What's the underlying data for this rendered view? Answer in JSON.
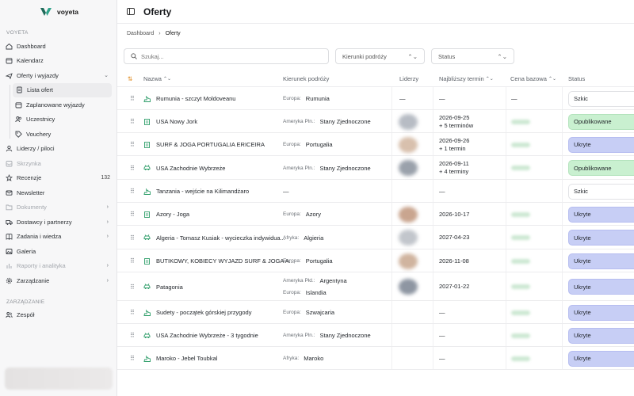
{
  "app": {
    "brand": "voyeta",
    "section_main": "VOYETA",
    "section_admin": "ZARZĄDZANIE"
  },
  "sidebar": {
    "items": [
      {
        "label": "Dashboard",
        "icon": "home-icon"
      },
      {
        "label": "Kalendarz",
        "icon": "calendar-icon"
      },
      {
        "label": "Oferty i wyjazdy",
        "icon": "plane-icon",
        "expanded": true
      },
      {
        "label": "Lista ofert",
        "icon": "doc-icon",
        "active": true
      },
      {
        "label": "Zaplanowane wyjazdy",
        "icon": "calendar-icon"
      },
      {
        "label": "Uczestnicy",
        "icon": "users-icon"
      },
      {
        "label": "Vouchery",
        "icon": "tag-icon"
      },
      {
        "label": "Liderzy / piloci",
        "icon": "user-icon"
      },
      {
        "label": "Skrzynka",
        "icon": "inbox-icon",
        "disabled": true
      },
      {
        "label": "Recenzje",
        "icon": "star-icon",
        "count": "132"
      },
      {
        "label": "Newsletter",
        "icon": "mail-icon"
      },
      {
        "label": "Dokumenty",
        "icon": "folder-icon",
        "disabled": true
      },
      {
        "label": "Dostawcy i partnerzy",
        "icon": "truck-icon"
      },
      {
        "label": "Zadania i wiedza",
        "icon": "book-icon"
      },
      {
        "label": "Galeria",
        "icon": "image-icon"
      },
      {
        "label": "Raporty i analityka",
        "icon": "chart-icon",
        "disabled": true
      },
      {
        "label": "Zarządzanie",
        "icon": "gear-icon"
      },
      {
        "label": "Zespół",
        "icon": "team-icon"
      }
    ]
  },
  "header": {
    "title": "Oferty"
  },
  "breadcrumb": {
    "root": "Dashboard",
    "current": "Oferty"
  },
  "filters": {
    "search_placeholder": "Szukaj...",
    "direction_placeholder": "Kierunki podróży",
    "status_placeholder": "Status"
  },
  "table": {
    "columns": {
      "name": "Nazwa",
      "direction": "Kierunek podróży",
      "leaders": "Liderzy",
      "next_term": "Najbliższy termin",
      "price": "Cena bazowa",
      "status": "Status"
    },
    "rows": [
      {
        "name": "Rumunia - szczyt Moldoveanu",
        "icon": "hiking-icon",
        "dirs": [
          {
            "region": "Europa:",
            "country": "Rumunia"
          }
        ],
        "leaders": "—",
        "term": [
          "—"
        ],
        "price": "—",
        "status": "Szkic",
        "status_kind": "szkic"
      },
      {
        "name": "USA Nowy Jork",
        "icon": "building-icon",
        "dirs": [
          {
            "region": "Ameryka Pln.:",
            "country": "Stany Zjednoczone"
          }
        ],
        "avatar": true,
        "term": [
          "2026-09-25",
          "+ 5 terminów"
        ],
        "price_blur": true,
        "status": "Opublikowane",
        "status_kind": "opub"
      },
      {
        "name": "SURF & JOGA PORTUGALIA ERICEIRA",
        "icon": "building-icon",
        "dirs": [
          {
            "region": "Europa:",
            "country": "Portugalia"
          }
        ],
        "avatar": true,
        "term": [
          "2026-09-26",
          "+ 1 termin"
        ],
        "price_blur": true,
        "status": "Ukryte",
        "status_kind": "ukryte"
      },
      {
        "name": "USA Zachodnie Wybrzeże",
        "icon": "car-icon",
        "dirs": [
          {
            "region": "Ameryka Pln.:",
            "country": "Stany Zjednoczone"
          }
        ],
        "avatar": true,
        "term": [
          "2026-09-11",
          "+ 4 terminy"
        ],
        "price_blur": true,
        "status": "Opublikowane",
        "status_kind": "opub"
      },
      {
        "name": "Tanzania - wejście na Kilimandżaro",
        "icon": "hiking-icon",
        "dirs": [],
        "dir_dash": "—",
        "term": [
          "—"
        ],
        "status": "Szkic",
        "status_kind": "szkic"
      },
      {
        "name": "Azory - Joga",
        "icon": "building-icon",
        "dirs": [
          {
            "region": "Europa:",
            "country": "Azory"
          }
        ],
        "avatar": true,
        "term": [
          "2026-10-17"
        ],
        "price_blur": true,
        "status": "Ukryte",
        "status_kind": "ukryte"
      },
      {
        "name": "Algeria - Tomasz Kusiak - wycieczka indywidua...",
        "icon": "car-icon",
        "dirs": [
          {
            "region": "Afryka:",
            "country": "Algieria"
          }
        ],
        "avatar": true,
        "term": [
          "2027-04-23"
        ],
        "price_blur": true,
        "status": "Ukryte",
        "status_kind": "ukryte"
      },
      {
        "name": "BUTIKOWY, KOBIECY WYJAZD SURF & JOGA A...",
        "icon": "building-icon",
        "dirs": [
          {
            "region": "Europa:",
            "country": "Portugalia"
          }
        ],
        "avatar": true,
        "term": [
          "2026-11-08"
        ],
        "price_blur": true,
        "status": "Ukryte",
        "status_kind": "ukryte"
      },
      {
        "name": "Patagonia",
        "icon": "car-icon",
        "dirs": [
          {
            "region": "Ameryka Płd.:",
            "country": "Argentyna"
          },
          {
            "region": "Europa:",
            "country": "Islandia"
          }
        ],
        "avatar": true,
        "term": [
          "2027-01-22"
        ],
        "price_blur": true,
        "status": "Ukryte",
        "status_kind": "ukryte"
      },
      {
        "name": "Sudety - początek górskiej przygody",
        "icon": "hiking-icon",
        "dirs": [
          {
            "region": "Europa:",
            "country": "Szwajcaria"
          }
        ],
        "term": [
          "—"
        ],
        "price_blur": true,
        "status": "Ukryte",
        "status_kind": "ukryte"
      },
      {
        "name": "USA Zachodnie Wybrzeże - 3 tygodnie",
        "icon": "car-icon",
        "dirs": [
          {
            "region": "Ameryka Pln.:",
            "country": "Stany Zjednoczone"
          }
        ],
        "term": [
          "—"
        ],
        "price_blur": true,
        "status": "Ukryte",
        "status_kind": "ukryte"
      },
      {
        "name": "Maroko - Jebel Toubkal",
        "icon": "hiking-icon",
        "dirs": [
          {
            "region": "Afryka:",
            "country": "Maroko"
          }
        ],
        "term": [
          "—"
        ],
        "price_blur": true,
        "status": "Ukryte",
        "status_kind": "ukryte"
      }
    ]
  },
  "colors": {
    "accent": "#2f9e6a",
    "draft_bg": "#ffffff",
    "published_bg": "#c9f0d0",
    "hidden_bg": "#c7cef5",
    "sort_icon": "#e08a1e"
  }
}
